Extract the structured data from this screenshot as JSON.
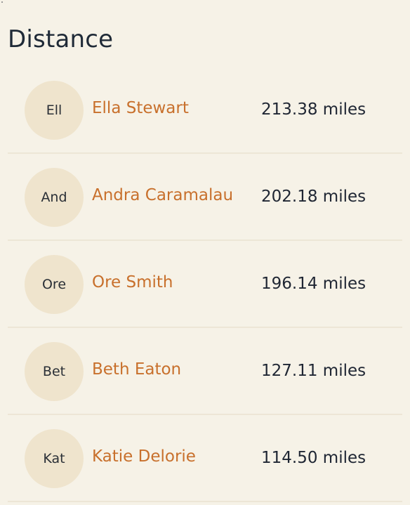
{
  "page": {
    "title": "Distance"
  },
  "leaderboard": [
    {
      "initials": "Ell",
      "name": "Ella Stewart",
      "distance": "213.38 miles"
    },
    {
      "initials": "And",
      "name": "Andra Caramalau",
      "distance": "202.18 miles"
    },
    {
      "initials": "Ore",
      "name": "Ore Smith",
      "distance": "196.14 miles"
    },
    {
      "initials": "Bet",
      "name": "Beth Eaton",
      "distance": "127.11 miles"
    },
    {
      "initials": "Kat",
      "name": "Katie Delorie",
      "distance": "114.50 miles"
    }
  ],
  "colors": {
    "background": "#f6f2e7",
    "accent": "#c8702c",
    "avatar_bg": "#efe4cd",
    "divider": "#ede6d6",
    "text": "#1f2633"
  }
}
